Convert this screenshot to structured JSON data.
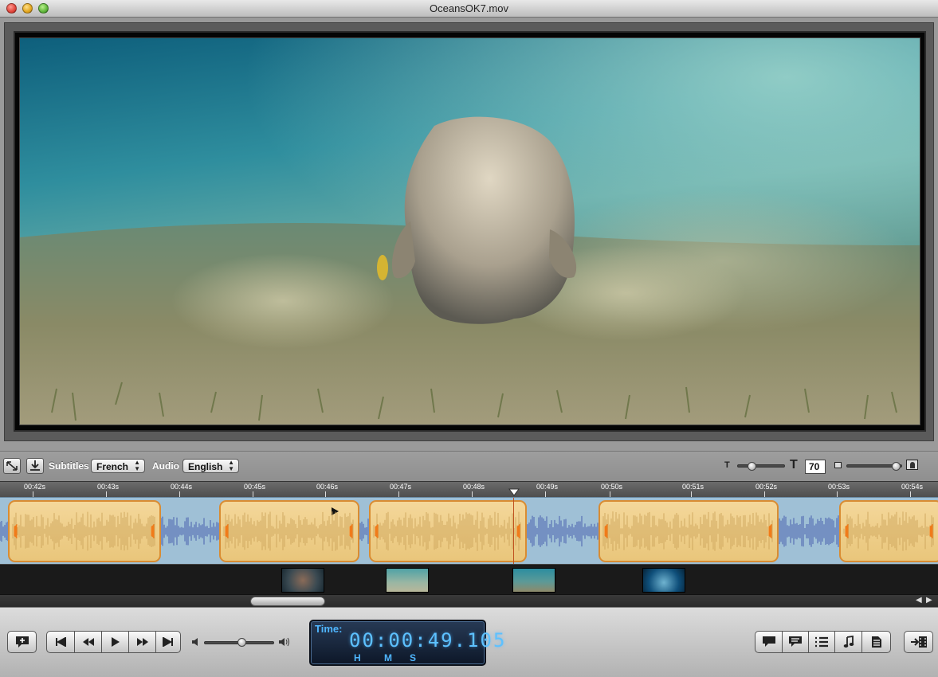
{
  "window": {
    "title": "OceansOK7.mov"
  },
  "toolbar": {
    "subtitles_label": "Subtitles",
    "subtitles_value": "French",
    "audio_label": "Audio",
    "audio_value": "English",
    "font_small_icon": "T",
    "font_large_icon": "T",
    "font_size": "70"
  },
  "timeline": {
    "ticks": [
      "00:42s",
      "00:43s",
      "00:44s",
      "00:45s",
      "00:46s",
      "00:47s",
      "00:48s",
      "00:49s",
      "00:50s",
      "00:51s",
      "00:52s",
      "00:53s",
      "00:54s"
    ],
    "playhead_time": "00:48.6s"
  },
  "timecode": {
    "label": "Time:",
    "value": "00:00:49.105",
    "unit_h": "H",
    "unit_m": "M",
    "unit_s": "S"
  },
  "colors": {
    "clip_fill": "#f4d79a",
    "clip_border": "#d98c32",
    "waveform": "#4a5fae",
    "track_bg": "#9fc0d6",
    "timecode_text": "#5dc1ff"
  }
}
